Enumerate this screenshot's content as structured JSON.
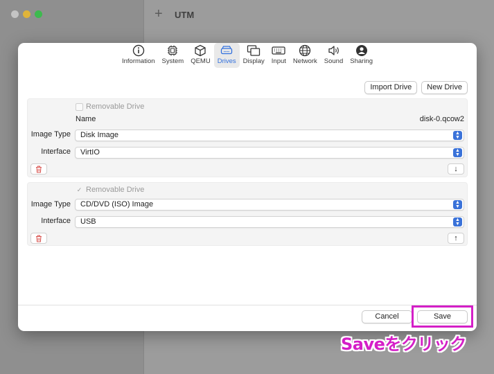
{
  "background": {
    "title": "UTM",
    "add_symbol": "+"
  },
  "tabs": [
    {
      "label": "Information",
      "icon": "info-icon",
      "active": false
    },
    {
      "label": "System",
      "icon": "cpu-icon",
      "active": false
    },
    {
      "label": "QEMU",
      "icon": "cube-icon",
      "active": false
    },
    {
      "label": "Drives",
      "icon": "drive-icon",
      "active": true
    },
    {
      "label": "Display",
      "icon": "display-icon",
      "active": false
    },
    {
      "label": "Input",
      "icon": "keyboard-icon",
      "active": false
    },
    {
      "label": "Network",
      "icon": "globe-icon",
      "active": false
    },
    {
      "label": "Sound",
      "icon": "speaker-icon",
      "active": false
    },
    {
      "label": "Sharing",
      "icon": "person-icon",
      "active": false
    }
  ],
  "toolbar": {
    "import_label": "Import Drive",
    "new_label": "New Drive"
  },
  "drives": [
    {
      "removable_label": "Removable Drive",
      "removable_checked": false,
      "name_label": "Name",
      "name_value": "disk-0.qcow2",
      "image_type_label": "Image Type",
      "image_type_value": "Disk Image",
      "interface_label": "Interface",
      "interface_value": "VirtIO",
      "move_symbol": "↓"
    },
    {
      "removable_label": "Removable Drive",
      "removable_checked": true,
      "check_symbol": "✓",
      "image_type_label": "Image Type",
      "image_type_value": "CD/DVD (ISO) Image",
      "interface_label": "Interface",
      "interface_value": "USB",
      "move_symbol": "↑"
    }
  ],
  "footer": {
    "cancel_label": "Cancel",
    "save_label": "Save"
  },
  "annotation": {
    "text": "Saveをクリック",
    "color": "#d41fc7"
  },
  "colors": {
    "accent": "#2f6fde",
    "trash": "#d9534f"
  }
}
